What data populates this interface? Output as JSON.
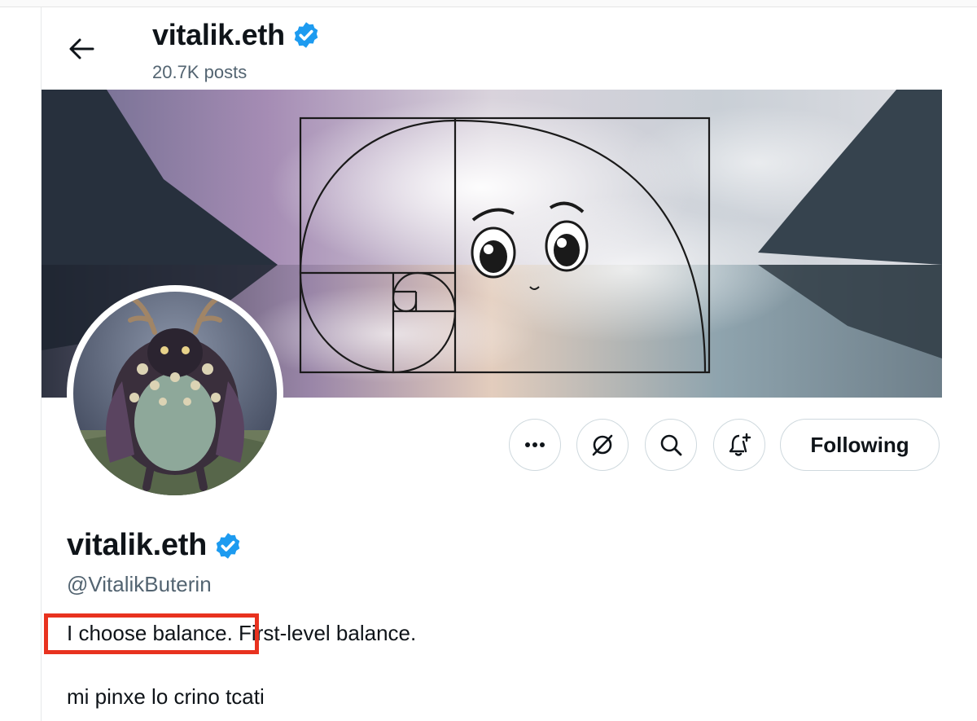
{
  "header": {
    "name": "vitalik.eth",
    "post_count": "20.7K posts"
  },
  "profile": {
    "name": "vitalik.eth",
    "handle": "@VitalikButerin",
    "bio_highlighted": "I choose balance.",
    "bio_rest": " First-level balance.",
    "bio_line2": "mi pinxe lo crino tcati"
  },
  "actions": {
    "following_label": "Following",
    "icons": [
      "more-icon",
      "grok-icon",
      "search-icon",
      "notification-subscribe-icon"
    ]
  },
  "colors": {
    "verified": "#1d9bf0",
    "highlight": "#e8321f",
    "secondary_text": "#536471"
  }
}
